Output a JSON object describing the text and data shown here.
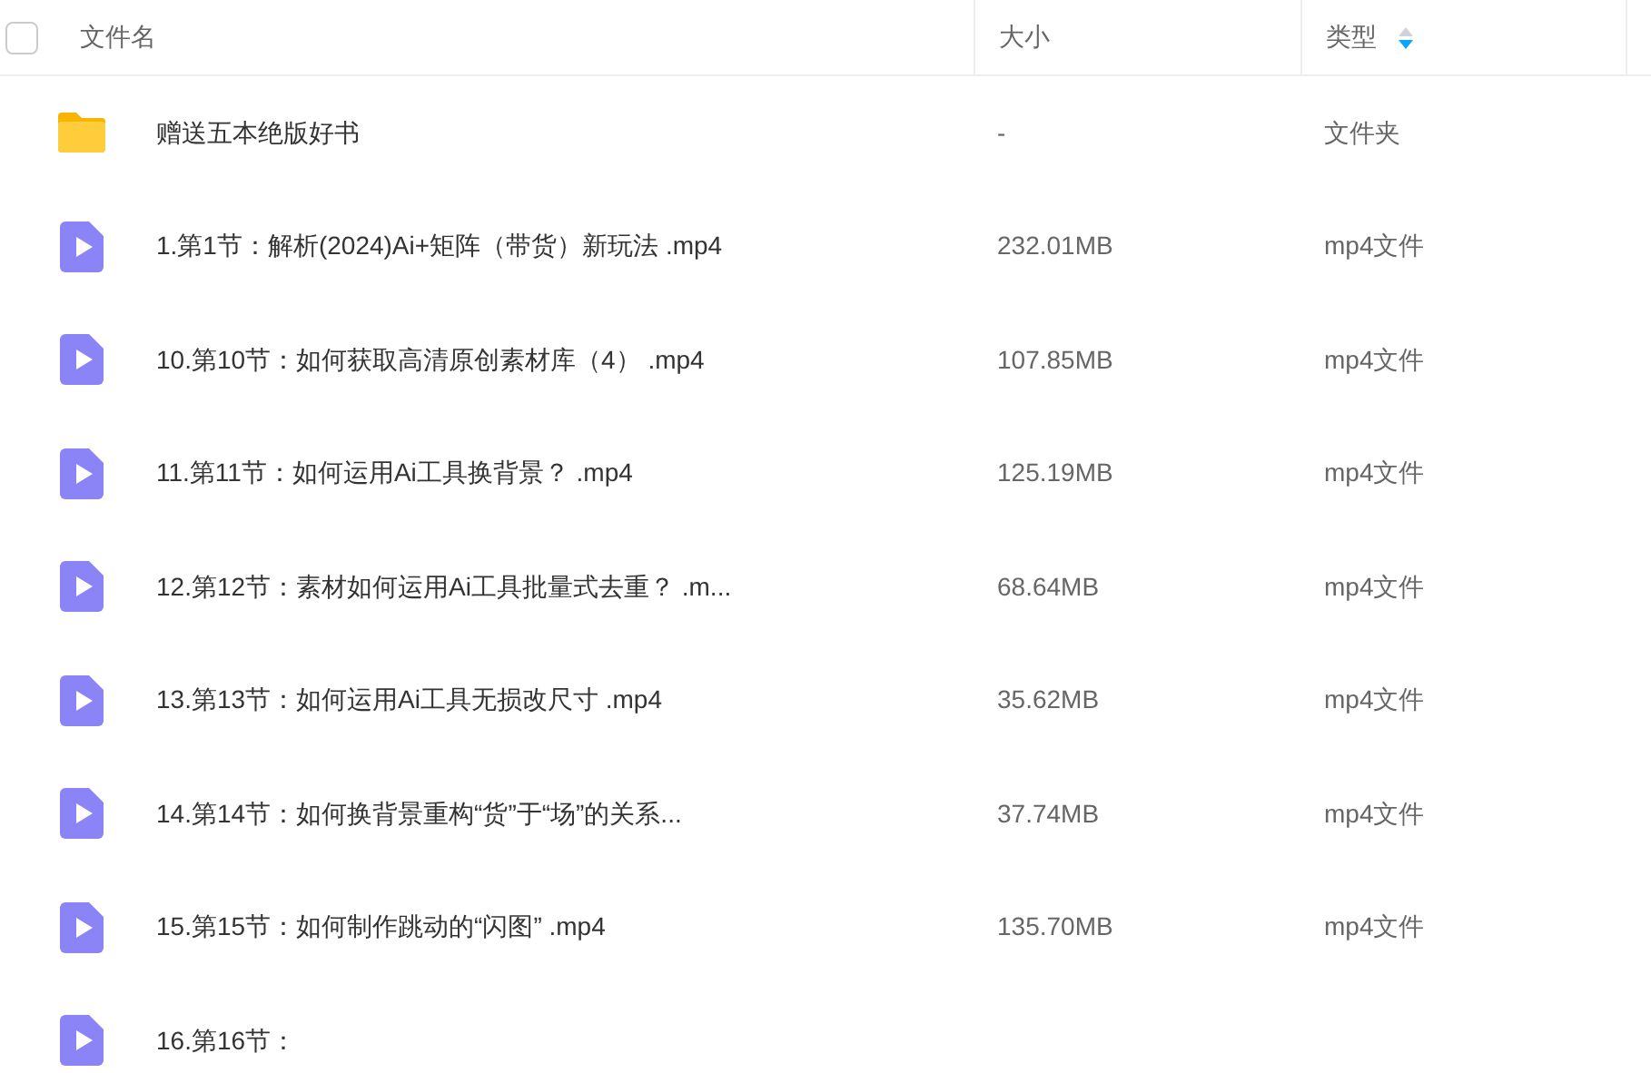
{
  "table": {
    "header_checkbox": {
      "checked": false
    },
    "columns": [
      {
        "label": "文件名"
      },
      {
        "label": "大小"
      },
      {
        "label": "类型",
        "sorted_descending": true
      }
    ],
    "rows": [
      {
        "kind": "folder",
        "name": "赠送五本绝版好书",
        "size": "-",
        "type": "文件夹"
      },
      {
        "kind": "video",
        "name": "1.第1节：解析(2024)Ai+矩阵（带货）新玩法 .mp4",
        "size": "232.01MB",
        "type": "mp4文件"
      },
      {
        "kind": "video",
        "name": "10.第10节：如何获取高清原创素材库（4） .mp4",
        "size": "107.85MB",
        "type": "mp4文件"
      },
      {
        "kind": "video",
        "name": "11.第11节：如何运用Ai工具换背景？ .mp4",
        "size": "125.19MB",
        "type": "mp4文件"
      },
      {
        "kind": "video",
        "name": "12.第12节：素材如何运用Ai工具批量式去重？ .m...",
        "size": "68.64MB",
        "type": "mp4文件"
      },
      {
        "kind": "video",
        "name": "13.第13节：如何运用Ai工具无损改尺寸 .mp4",
        "size": "35.62MB",
        "type": "mp4文件"
      },
      {
        "kind": "video",
        "name": "14.第14节：如何换背景重构“货”于“场”的关系...",
        "size": "37.74MB",
        "type": "mp4文件"
      },
      {
        "kind": "video",
        "name": "15.第15节：如何制作跳动的“闪图” .mp4",
        "size": "135.70MB",
        "type": "mp4文件"
      },
      {
        "kind": "video",
        "name": "16.第16节："
      }
    ]
  }
}
